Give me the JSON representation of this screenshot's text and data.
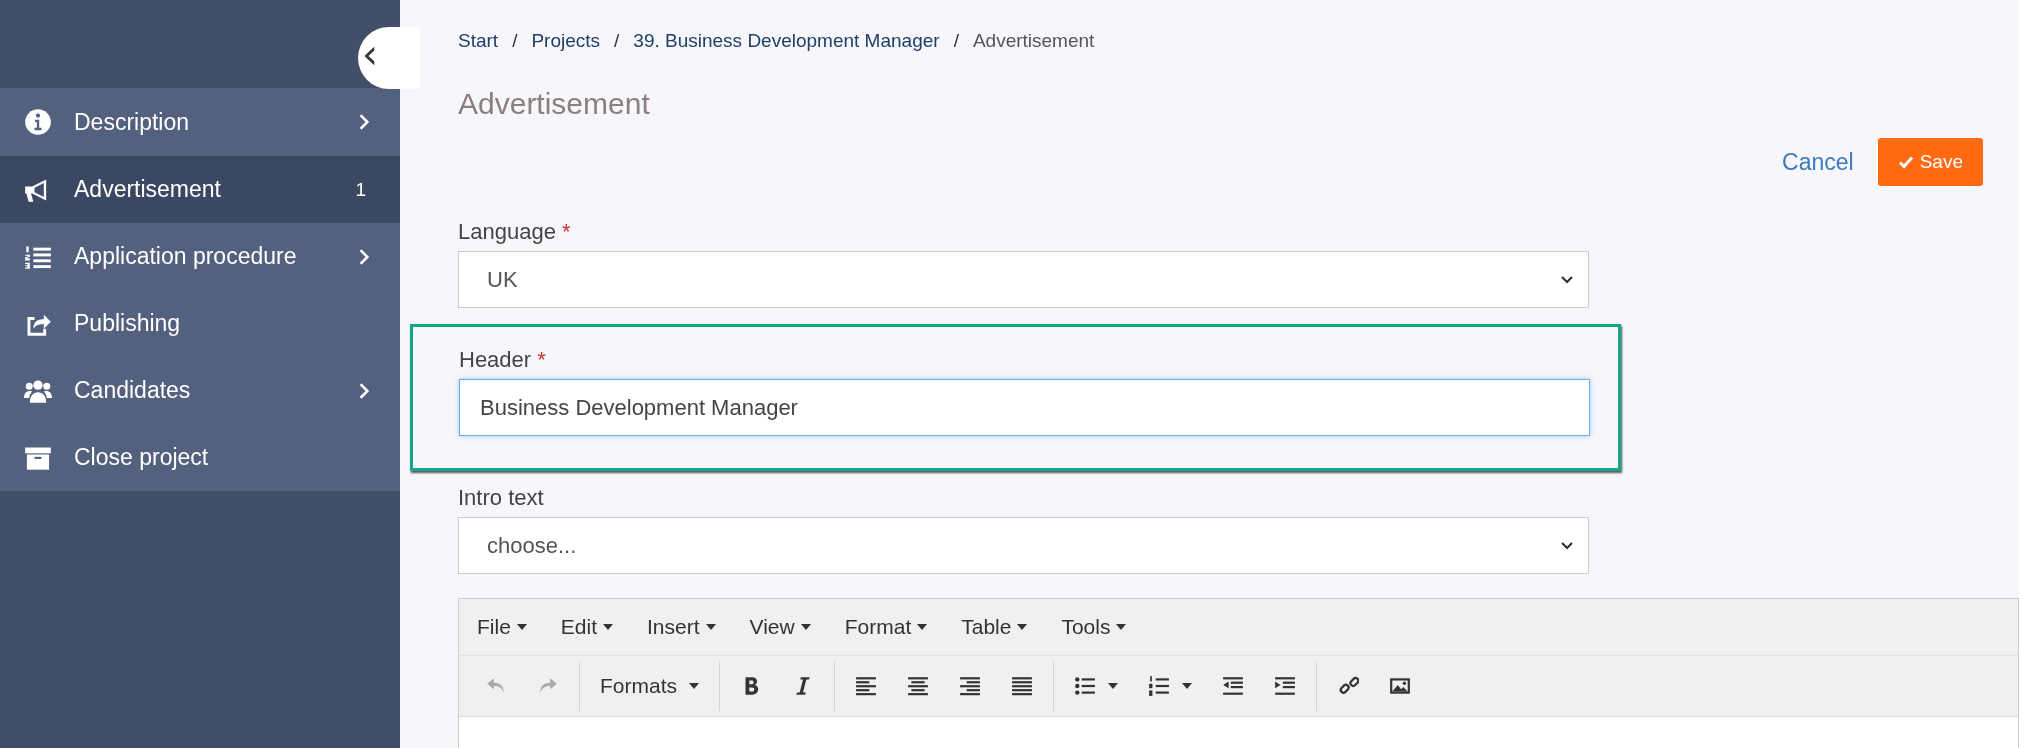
{
  "sidebar": {
    "collapse_button": {
      "label": "‹"
    },
    "items": [
      {
        "label": "Description",
        "selected": false,
        "expandable": true
      },
      {
        "label": "Advertisement",
        "selected": true,
        "badge": "1",
        "expandable": false
      },
      {
        "label": "Application procedure",
        "selected": false,
        "expandable": true
      },
      {
        "label": "Publishing",
        "selected": false,
        "expandable": false
      },
      {
        "label": "Candidates",
        "selected": false,
        "expandable": true
      },
      {
        "label": "Close project",
        "selected": false,
        "expandable": false
      }
    ]
  },
  "breadcrumb": [
    {
      "label": "Start",
      "current": false
    },
    {
      "separator": "/",
      "label": "Projects",
      "current": false
    },
    {
      "separator": "/",
      "label": "39. Business Development Manager",
      "current": false
    },
    {
      "separator": "/",
      "label": "Advertisement",
      "current": true
    }
  ],
  "page_title": "Advertisement",
  "actions": {
    "cancel": "Cancel",
    "save": "Save"
  },
  "fields": [
    {
      "kind": "select",
      "label": "Language",
      "required_mark": "*",
      "value": "UK",
      "focused": false,
      "highlighted": false
    },
    {
      "kind": "text",
      "label": "Header",
      "required_mark": "*",
      "value": "Business Development Manager",
      "focused": true,
      "highlighted": true
    },
    {
      "kind": "select",
      "label": "Intro text",
      "value": "choose...",
      "focused": false,
      "highlighted": false
    }
  ],
  "editor": {
    "menus": [
      "File",
      "Edit",
      "Insert",
      "View",
      "Format",
      "Table",
      "Tools"
    ],
    "toolbar": [
      [
        {
          "kind": "undo",
          "disabled": true
        },
        {
          "kind": "redo",
          "disabled": true
        }
      ],
      [
        {
          "kind": "formats",
          "label": "Formats",
          "disabled": false
        }
      ],
      [
        {
          "kind": "bold",
          "disabled": false
        },
        {
          "kind": "italic",
          "disabled": false
        }
      ],
      [
        {
          "kind": "align-left",
          "disabled": false
        },
        {
          "kind": "align-center",
          "disabled": false
        },
        {
          "kind": "align-right",
          "disabled": false
        },
        {
          "kind": "justify",
          "disabled": false
        }
      ],
      [
        {
          "kind": "bullet-list",
          "disabled": false
        },
        {
          "kind": "numbered-list",
          "disabled": false
        },
        {
          "kind": "outdent",
          "disabled": false
        },
        {
          "kind": "indent",
          "disabled": false
        }
      ],
      [
        {
          "kind": "link",
          "disabled": false
        },
        {
          "kind": "image",
          "disabled": false
        }
      ]
    ]
  }
}
